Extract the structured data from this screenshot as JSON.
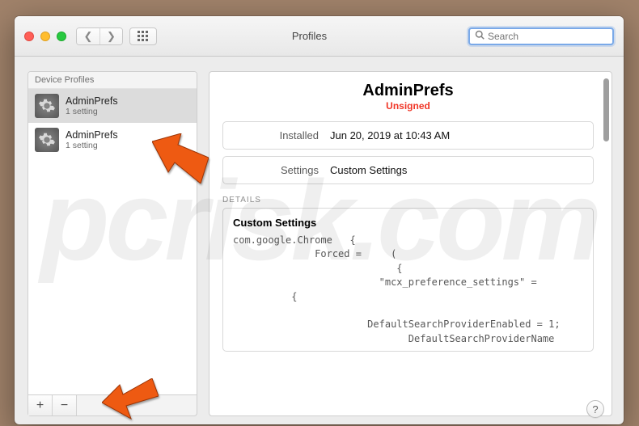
{
  "window": {
    "title": "Profiles"
  },
  "search": {
    "placeholder": "Search"
  },
  "sidebar": {
    "header": "Device Profiles",
    "items": [
      {
        "name": "AdminPrefs",
        "meta": "1 setting"
      },
      {
        "name": "AdminPrefs",
        "meta": "1 setting"
      }
    ],
    "add": "+",
    "remove": "−"
  },
  "profile": {
    "title": "AdminPrefs",
    "unsigned": "Unsigned",
    "rows": [
      {
        "label": "Installed",
        "value": "Jun 20, 2019 at 10:43 AM"
      },
      {
        "label": "Settings",
        "value": "Custom Settings"
      }
    ],
    "details_label": "DETAILS",
    "details_section": "Custom Settings",
    "details_body": "com.google.Chrome   {\n              Forced =     (\n                            {\n                         \"mcx_preference_settings\" =\n          {\n\n                       DefaultSearchProviderEnabled = 1;\n                              DefaultSearchProviderName"
  },
  "help": "?",
  "watermark": "pcrisk.com"
}
